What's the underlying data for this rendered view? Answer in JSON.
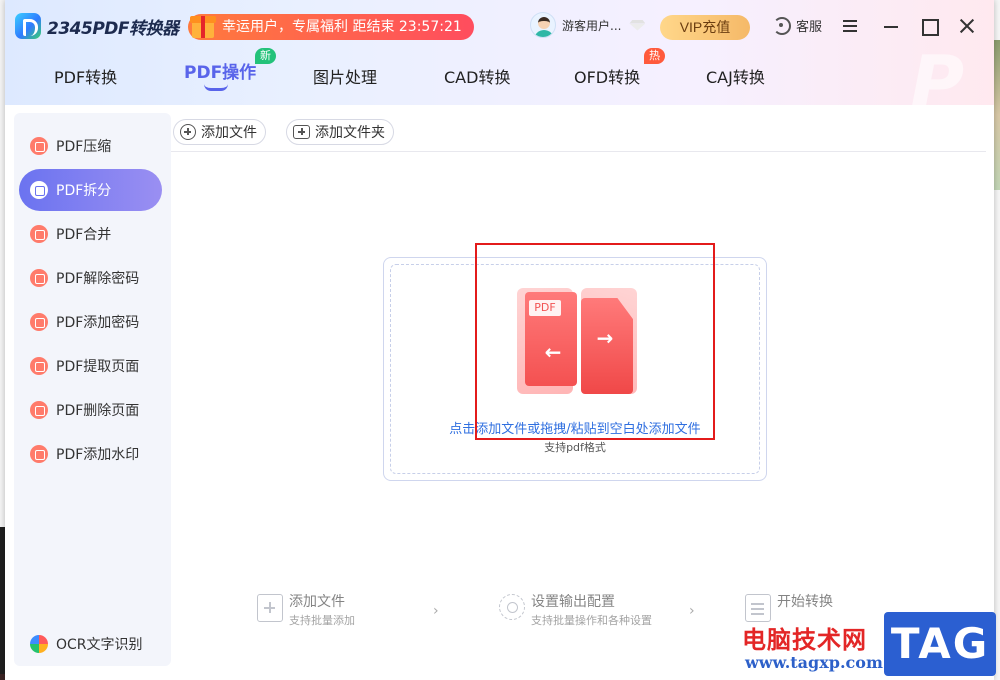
{
  "app": {
    "logo_text": "2345PDF转换器"
  },
  "promo": {
    "text": "幸运用户，专属福利 距结束 23:57:21"
  },
  "user": {
    "name": "游客用户..."
  },
  "vip_button": "VIP充值",
  "service_label": "客服",
  "nav": {
    "tabs": [
      {
        "label": "PDF转换"
      },
      {
        "label": "PDF操作",
        "active": true,
        "badge": "新"
      },
      {
        "label": "图片处理"
      },
      {
        "label": "CAD转换"
      },
      {
        "label": "OFD转换",
        "badge": "热"
      },
      {
        "label": "CAJ转换"
      }
    ]
  },
  "sidebar": {
    "items": [
      {
        "label": "PDF压缩"
      },
      {
        "label": "PDF拆分",
        "active": true
      },
      {
        "label": "PDF合并"
      },
      {
        "label": "PDF解除密码"
      },
      {
        "label": "PDF添加密码"
      },
      {
        "label": "PDF提取页面"
      },
      {
        "label": "PDF删除页面"
      },
      {
        "label": "PDF添加水印"
      }
    ],
    "ocr_label": "OCR文字识别"
  },
  "toolbar": {
    "add_file": "添加文件",
    "add_folder": "添加文件夹"
  },
  "dropzone": {
    "pdf_tag": "PDF",
    "hint": "点击添加文件或拖拽/粘贴到空白处添加文件",
    "sub": "支持pdf格式"
  },
  "steps": [
    {
      "title": "添加文件",
      "sub": "支持批量添加"
    },
    {
      "title": "设置输出配置",
      "sub": "支持批量操作和各种设置"
    },
    {
      "title": "开始转换",
      "sub": ""
    }
  ],
  "watermark": {
    "cn": "电脑技术网",
    "url": "www.tagxp.com",
    "tag": "TAG"
  },
  "colors": {
    "accent": "#5964ea",
    "highlight_box": "#e31b1b",
    "icon_red": "#ff7b6b"
  }
}
